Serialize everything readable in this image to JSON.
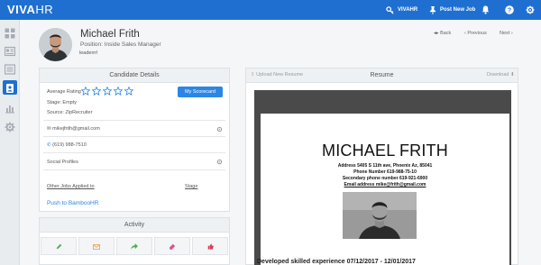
{
  "app": {
    "logo_main": "VIVA",
    "logo_sub": "HR",
    "brand_color": "#1f6fd1"
  },
  "topbar": {
    "account_label": "VIVAHR",
    "post_job_label": "Post New Job"
  },
  "sidebar": {
    "items": [
      "dashboard-icon",
      "jobs-icon",
      "listings-icon",
      "candidates-icon",
      "reports-icon",
      "settings-icon"
    ],
    "active": "candidates-icon"
  },
  "candidate": {
    "name": "Michael Frith",
    "position": "Position: Inside Sales Manager",
    "tags_value": "leaderrrl"
  },
  "nav": {
    "back": "Back",
    "previous": "Previous",
    "next": "Next"
  },
  "details": {
    "header": "Candidate Details",
    "avg_rating_label": "Average Rating",
    "rating": 0,
    "rating_max": 5,
    "scorecard_button": "My Scorecard",
    "stage": "Stage: Empty",
    "source": "Source: ZipRecruiter",
    "email": "mikejfrith@gmail.com",
    "phone": "(619) 988-7510",
    "social_label": "Social Profiles",
    "other_jobs_label": "Other Jobs Applied to",
    "stage_col_label": "Stage",
    "push_link": "Push to BambooHR"
  },
  "activity": {
    "header": "Activity",
    "buttons": [
      "pencil-icon",
      "envelope-icon",
      "share-icon",
      "eraser-icon",
      "thumbs-up-icon"
    ]
  },
  "resume": {
    "upload_label": "Upload New Resume",
    "header": "Resume",
    "download_label": "Download",
    "doc_name": "MICHAEL FRITH",
    "address": "Address 5405 S 11th ave, Phoenix Az, 85041",
    "phone": "Phone Number 619-988-75-10",
    "secondary_phone": "Secondary phone number 619-921-6900",
    "email": "Email address mike@frith@gmail.com",
    "experience_line": "Developed skilled experience   07/12/2017 - 12/01/2017"
  }
}
